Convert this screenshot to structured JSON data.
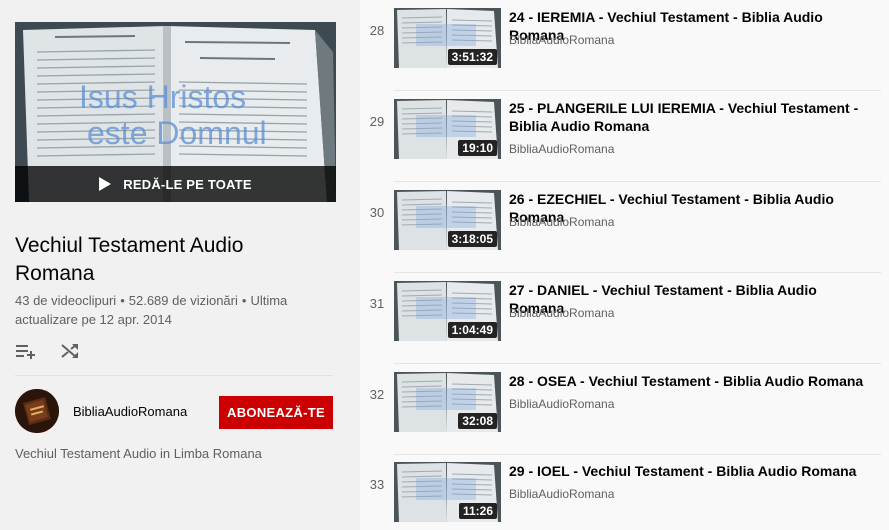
{
  "playlist": {
    "play_all_label": "REDĂ-LE PE TOATE",
    "title": "Vechiul Testament Audio Romana",
    "video_count": "43 de videoclipuri",
    "views": "52.689 de vizionări",
    "updated": "Ultima actualizare pe 12 apr. 2014",
    "thumbnail_overlay_line1": "Isus Hristos",
    "thumbnail_overlay_line2": "este Domnul",
    "description": "Vechiul Testament Audio in Limba Romana"
  },
  "owner": {
    "name": "BibliaAudioRomana",
    "subscribe_label": "ABONEAZĂ-TE"
  },
  "icons": {
    "add_to_queue": "playlist-add-icon",
    "shuffle": "shuffle-icon",
    "play": "play-icon"
  },
  "colors": {
    "subscribe_bg": "#cc0000",
    "sidebar_bg": "#f1f1f1",
    "secondary_text": "#606060"
  },
  "videos": [
    {
      "index": "28",
      "title": "24 - IEREMIA - Vechiul Testament - Biblia Audio Romana",
      "channel": "BibliaAudioRomana",
      "duration": "3:51:32"
    },
    {
      "index": "29",
      "title": "25 - PLANGERILE LUI IEREMIA - Vechiul Testament - Biblia Audio Romana",
      "channel": "BibliaAudioRomana",
      "duration": "19:10"
    },
    {
      "index": "30",
      "title": "26 - EZECHIEL - Vechiul Testament - Biblia Audio Romana",
      "channel": "BibliaAudioRomana",
      "duration": "3:18:05"
    },
    {
      "index": "31",
      "title": "27 - DANIEL - Vechiul Testament - Biblia Audio Romana",
      "channel": "BibliaAudioRomana",
      "duration": "1:04:49"
    },
    {
      "index": "32",
      "title": "28 - OSEA - Vechiul Testament - Biblia Audio Romana",
      "channel": "BibliaAudioRomana",
      "duration": "32:08"
    },
    {
      "index": "33",
      "title": "29 - IOEL - Vechiul Testament - Biblia Audio Romana",
      "channel": "BibliaAudioRomana",
      "duration": "11:26"
    }
  ]
}
